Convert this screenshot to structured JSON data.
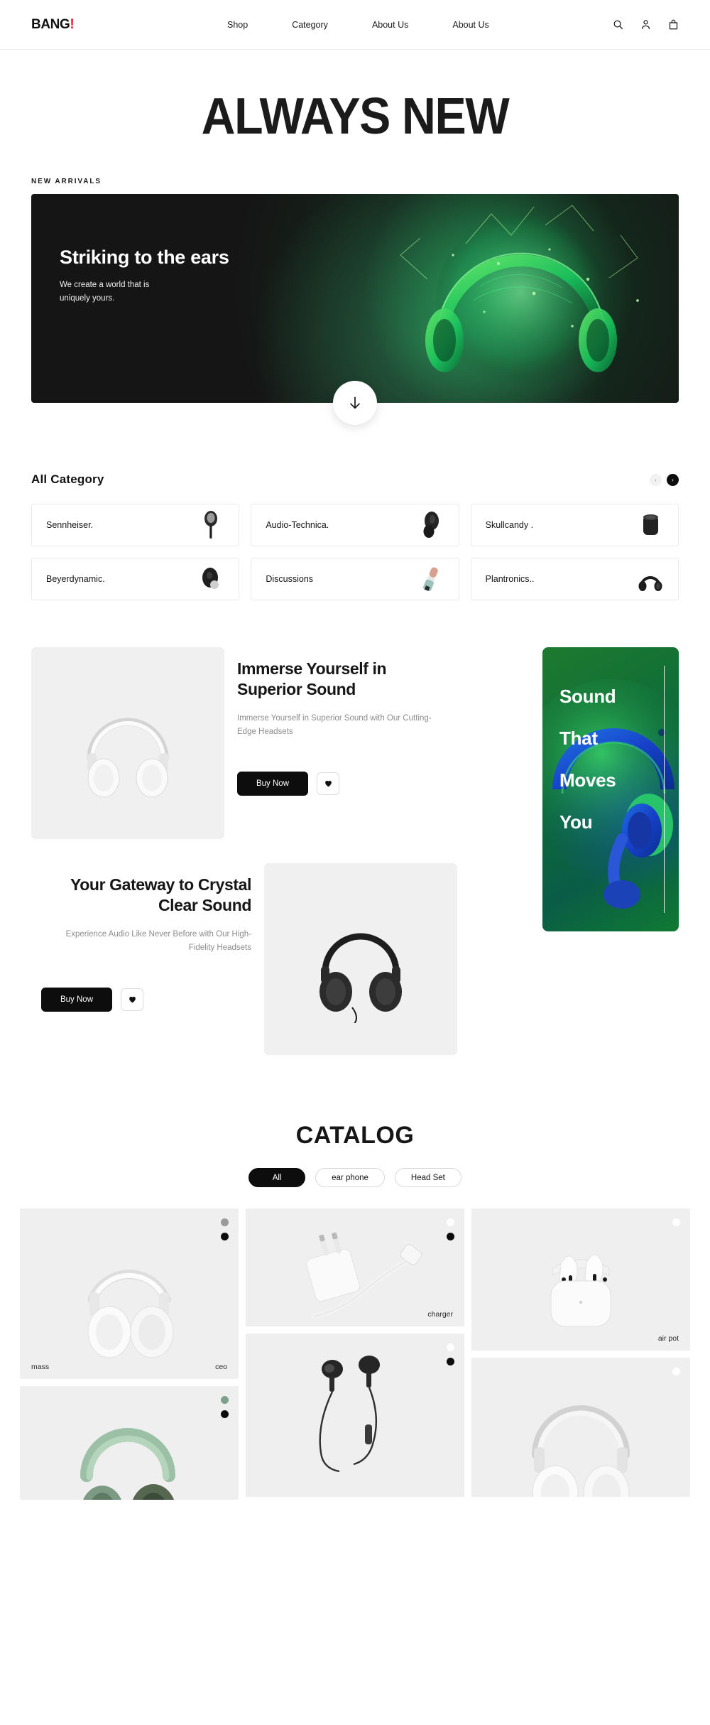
{
  "header": {
    "logo_main": "BANG",
    "logo_mark": "!",
    "nav": [
      {
        "label": "Shop"
      },
      {
        "label": "Category"
      },
      {
        "label": "About Us"
      },
      {
        "label": "About Us"
      }
    ],
    "icons": [
      {
        "name": "search-icon"
      },
      {
        "name": "user-icon"
      },
      {
        "name": "bag-icon"
      }
    ]
  },
  "hero": {
    "title": "ALWAYS NEW",
    "section_label": "NEW ARRIVALS",
    "banner_heading": "Striking to the ears",
    "banner_text_line1": "We create a world that is",
    "banner_text_line2": "uniquely yours.",
    "scroll_icon": "arrow-down-icon",
    "banner_bg": "#151515"
  },
  "category": {
    "title": "All Category",
    "prev_label": "‹",
    "next_label": "›",
    "items": [
      {
        "label": "Sennheiser.",
        "thumb": "earbud-wired"
      },
      {
        "label": "Audio-Technica.",
        "thumb": "earbud-black"
      },
      {
        "label": "Skullcandy .",
        "thumb": "speaker-black"
      },
      {
        "label": "Beyerdynamic.",
        "thumb": "earbud-round"
      },
      {
        "label": "Discussions",
        "thumb": "mic-pastel"
      },
      {
        "label": "Plantronics..",
        "thumb": "headphone-black"
      }
    ]
  },
  "feature": {
    "block1": {
      "heading": "Immerse Yourself in Superior Sound",
      "text": "Immerse Yourself in Superior Sound with Our Cutting-Edge Headsets",
      "buy_label": "Buy Now",
      "wishlist_icon": "heart-icon",
      "product_image": "white-headphones"
    },
    "block2": {
      "heading": "Your Gateway to Crystal Clear Sound",
      "text": "Experience Audio Like Never Before with Our High-Fidelity Headsets",
      "buy_label": "Buy Now",
      "wishlist_icon": "heart-icon",
      "product_image": "black-headphones"
    },
    "promo": {
      "words": [
        "Sound",
        "That",
        "Moves",
        "You"
      ],
      "bg_color": "#0d6b3a",
      "accent_color": "#1a5ac8"
    }
  },
  "catalog": {
    "title": "CATALOG",
    "filters": [
      {
        "label": "All",
        "active": true
      },
      {
        "label": "ear phone",
        "active": false
      },
      {
        "label": "Head Set",
        "active": false
      }
    ],
    "products": [
      {
        "image": "white-over-ear",
        "label_left": "mass",
        "label_right": "ceo",
        "dots": [
          "#9a9a9a",
          "#0d0d0d"
        ]
      },
      {
        "image": "green-over-ear",
        "label_left": "",
        "label_right": "",
        "dots": [
          "#7fa08a",
          "#0d0d0d"
        ]
      },
      {
        "image": "white-charger",
        "label_left": "",
        "label_right": "charger",
        "dots": [
          "#ffffff",
          "#0d0d0d"
        ]
      },
      {
        "image": "black-earbuds",
        "label_left": "",
        "label_right": "",
        "dots": [
          "#ffffff",
          "#0d0d0d"
        ]
      },
      {
        "image": "airpods-case",
        "label_left": "",
        "label_right": "air pot",
        "dots": [
          "#ffffff"
        ]
      },
      {
        "image": "silver-over-ear",
        "label_left": "",
        "label_right": "",
        "dots": [
          "#ffffff"
        ]
      }
    ]
  }
}
